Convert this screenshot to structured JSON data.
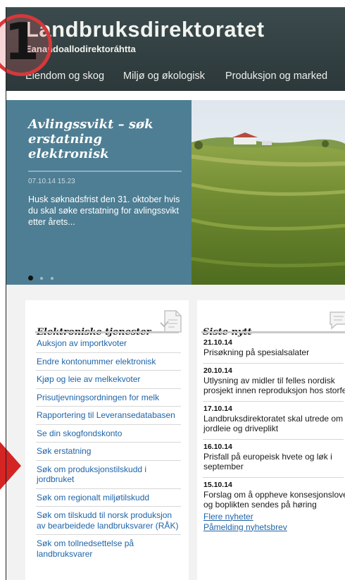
{
  "header": {
    "title": "Landbruksdirektoratet",
    "subtitle": "Eanandoallodirektoráhtta",
    "badge_number": "1"
  },
  "nav": {
    "items": [
      "Eiendom og skog",
      "Miljø og økologisk",
      "Produksjon og marked"
    ]
  },
  "hero": {
    "title": "Avlingssvikt – søk erstatning elektronisk",
    "date": "07.10.14 15.23",
    "text": "Husk søknadsfrist den 31. oktober hvis du skal søke erstatning for avlingssvikt etter årets...",
    "slide_count": 3,
    "active_slide": 1
  },
  "services": {
    "title": "Elektroniske tjenester",
    "items": [
      "Auksjon av importkvoter",
      "Endre kontonummer elektronisk",
      "Kjøp og leie av melkekvoter",
      "Prisutjevningsordningen for melk",
      "Rapportering til Leveransedatabasen",
      "Se din skogfondskonto",
      "Søk erstatning",
      "Søk om produksjonstilskudd i jordbruket",
      "Søk om regionalt miljøtilskudd",
      "Søk om tilskudd til norsk produksjon av bearbeidede landbruksvarer (RÅK)",
      "Søk om tollnedsettelse på landbruksvarer"
    ]
  },
  "news": {
    "title": "Siste nytt",
    "items": [
      {
        "date": "21.10.14",
        "text": "Prisøkning på spesialsalater"
      },
      {
        "date": "20.10.14",
        "text": "Utlysning av midler til felles nordisk prosjekt innen reproduksjon hos storfe"
      },
      {
        "date": "17.10.14",
        "text": "Landbruksdirektoratet skal utrede om jordleie og driveplikt"
      },
      {
        "date": "16.10.14",
        "text": "Prisfall på europeisk hvete og løk i september"
      },
      {
        "date": "15.10.14",
        "text": "Forslag om å oppheve konsesjonsloven og boplikten sendes på høring"
      }
    ],
    "links": [
      "Flere nyheter",
      "Påmelding nyhetsbrev"
    ]
  },
  "colors": {
    "header_bg": "#33413f",
    "hero_panel": "#4e7e93",
    "link": "#1e64a8",
    "annotation_red": "#d42424"
  }
}
